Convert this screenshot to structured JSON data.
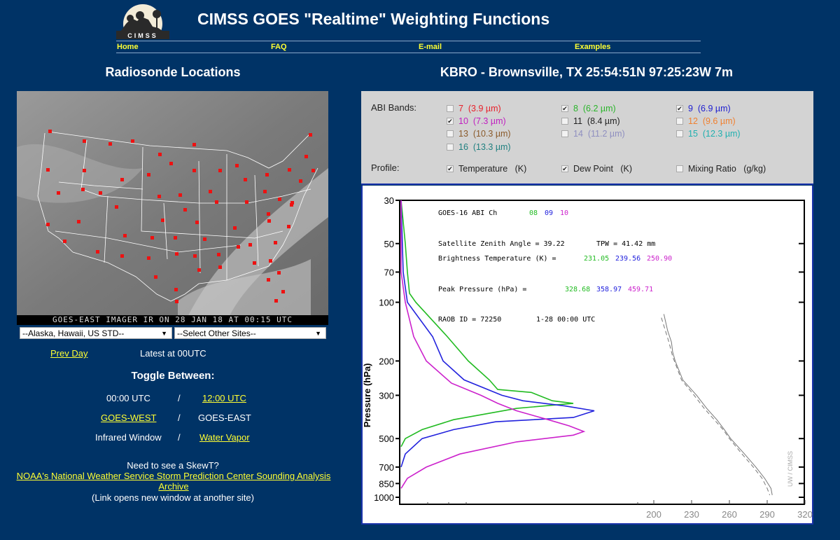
{
  "header": {
    "logo_text": "CIMSS",
    "title": "CIMSS GOES \"Realtime\" Weighting Functions",
    "nav": [
      {
        "label": "Home"
      },
      {
        "label": "FAQ"
      },
      {
        "label": "E-mail"
      },
      {
        "label": "Examples"
      }
    ]
  },
  "left": {
    "heading": "Radiosonde Locations",
    "map_caption": "GOES-EAST IMAGER IR ON 28 JAN 18 AT 00:15 UTC",
    "select_region": "--Alaska, Hawaii, US STD--",
    "select_other": "--Select Other Sites--",
    "prev_day": "Prev Day",
    "latest": "Latest at 00UTC",
    "toggle_heading": "Toggle Between:",
    "toggles": [
      {
        "left": "00:00 UTC",
        "left_link": false,
        "sep": "/",
        "right": "12:00 UTC",
        "right_link": true
      },
      {
        "left": "GOES-WEST",
        "left_link": true,
        "sep": "/",
        "right": "GOES-EAST",
        "right_link": false
      },
      {
        "left": "Infrared Window",
        "left_link": false,
        "sep": "/",
        "right": "Water Vapor",
        "right_link": true
      }
    ],
    "skewt_question": "Need to see a SkewT?",
    "skewt_link": "NOAA's National Weather Service Storm Prediction Center Sounding Analysis Archive",
    "skewt_note": "(Link opens new window at another site)"
  },
  "right": {
    "heading": "KBRO - Brownsville, TX 25:54:51N 97:25:23W 7m",
    "abi_label": "ABI Bands:",
    "profile_label": "Profile:",
    "bands": [
      {
        "num": "7",
        "wl": "(3.9 µm)",
        "checked": false,
        "color": "#e8202a"
      },
      {
        "num": "8",
        "wl": "(6.2 µm)",
        "checked": true,
        "color": "#2bb52b"
      },
      {
        "num": "9",
        "wl": "(6.9 µm)",
        "checked": true,
        "color": "#2020d0"
      },
      {
        "num": "10",
        "wl": "(7.3 µm)",
        "checked": true,
        "color": "#c020c0"
      },
      {
        "num": "11",
        "wl": "(8.4 µm)",
        "checked": false,
        "color": "#222222"
      },
      {
        "num": "12",
        "wl": "(9.6 µm)",
        "checked": false,
        "color": "#f08030"
      },
      {
        "num": "13",
        "wl": "(10.3 µm)",
        "checked": false,
        "color": "#8a5a2a"
      },
      {
        "num": "14",
        "wl": "(11.2 µm)",
        "checked": false,
        "color": "#8f8fc0"
      },
      {
        "num": "15",
        "wl": "(12.3 µm)",
        "checked": false,
        "color": "#20b0b0"
      },
      {
        "num": "16",
        "wl": "(13.3 µm)",
        "checked": false,
        "color": "#208080"
      }
    ],
    "profiles": [
      {
        "label": "Temperature   (K)",
        "checked": true
      },
      {
        "label": "Dew Point   (K)",
        "checked": true
      },
      {
        "label": "Mixing Ratio   (g/kg)",
        "checked": false
      }
    ]
  },
  "chart_data": {
    "type": "line",
    "title": "GOES-16 ABI Ch",
    "channels": [
      "08",
      "09",
      "10"
    ],
    "channel_colors": [
      "#22bb22",
      "#2222dd",
      "#cc22cc"
    ],
    "ylabel": "Pressure (hPa)",
    "yscale": "log",
    "ylim": [
      30,
      1000
    ],
    "yticks": [
      30,
      50,
      70,
      100,
      200,
      300,
      500,
      700,
      850,
      1000
    ],
    "xticks_temperature": [
      200,
      230,
      260,
      290,
      320
    ],
    "xlim_temperature": [
      200,
      320
    ],
    "annotations": {
      "zenith": "Satellite Zenith Angle = 39.22",
      "tpw": "TPW = 41.42 mm",
      "bt_label": "Brightness Temperature (K) =",
      "bt_values": [
        "231.05",
        "239.56",
        "250.90"
      ],
      "peak_label": "Peak Pressure (hPa) =",
      "peak_values": [
        "328.68",
        "358.97",
        "459.71"
      ],
      "raob": "RAOB ID = 72250",
      "time": "1-28 00:00 UTC",
      "credit": "UW / CIMSS"
    },
    "weighting_series": [
      {
        "name": "08",
        "points": [
          [
            30,
            0.0
          ],
          [
            50,
            0.02
          ],
          [
            70,
            0.03
          ],
          [
            90,
            0.04
          ],
          [
            100,
            0.07
          ],
          [
            150,
            0.22
          ],
          [
            200,
            0.32
          ],
          [
            250,
            0.42
          ],
          [
            280,
            0.46
          ],
          [
            290,
            0.62
          ],
          [
            320,
            0.72
          ],
          [
            330,
            0.82
          ],
          [
            350,
            0.55
          ],
          [
            400,
            0.25
          ],
          [
            450,
            0.1
          ],
          [
            500,
            0.02
          ],
          [
            550,
            0.0
          ]
        ]
      },
      {
        "name": "09",
        "points": [
          [
            30,
            0.0
          ],
          [
            70,
            0.01
          ],
          [
            100,
            0.03
          ],
          [
            150,
            0.15
          ],
          [
            200,
            0.2
          ],
          [
            250,
            0.3
          ],
          [
            300,
            0.48
          ],
          [
            320,
            0.58
          ],
          [
            340,
            0.78
          ],
          [
            360,
            0.92
          ],
          [
            390,
            0.82
          ],
          [
            410,
            0.45
          ],
          [
            450,
            0.25
          ],
          [
            500,
            0.1
          ],
          [
            600,
            0.02
          ],
          [
            700,
            0.0
          ]
        ]
      },
      {
        "name": "10",
        "points": [
          [
            30,
            0.0
          ],
          [
            70,
            0.0
          ],
          [
            100,
            0.02
          ],
          [
            150,
            0.06
          ],
          [
            200,
            0.12
          ],
          [
            260,
            0.24
          ],
          [
            300,
            0.38
          ],
          [
            330,
            0.46
          ],
          [
            360,
            0.55
          ],
          [
            400,
            0.7
          ],
          [
            430,
            0.8
          ],
          [
            460,
            0.87
          ],
          [
            480,
            0.82
          ],
          [
            520,
            0.55
          ],
          [
            600,
            0.28
          ],
          [
            700,
            0.12
          ],
          [
            800,
            0.03
          ],
          [
            900,
            0.0
          ]
        ]
      }
    ],
    "temperature": [
      [
        115,
        208
      ],
      [
        140,
        211
      ],
      [
        160,
        214
      ],
      [
        180,
        215
      ],
      [
        200,
        217
      ],
      [
        250,
        223
      ],
      [
        300,
        234
      ],
      [
        350,
        242
      ],
      [
        400,
        250
      ],
      [
        450,
        256
      ],
      [
        500,
        261
      ],
      [
        600,
        272
      ],
      [
        700,
        281
      ],
      [
        800,
        288
      ],
      [
        900,
        293
      ],
      [
        975,
        294
      ]
    ],
    "dewpoint": [
      [
        120,
        206
      ],
      [
        160,
        212
      ],
      [
        190,
        215
      ],
      [
        250,
        222
      ],
      [
        300,
        232
      ],
      [
        350,
        240
      ],
      [
        400,
        248
      ],
      [
        450,
        255
      ],
      [
        500,
        260
      ],
      [
        600,
        270
      ],
      [
        700,
        279
      ],
      [
        800,
        286
      ],
      [
        900,
        290
      ],
      [
        975,
        292
      ]
    ]
  }
}
